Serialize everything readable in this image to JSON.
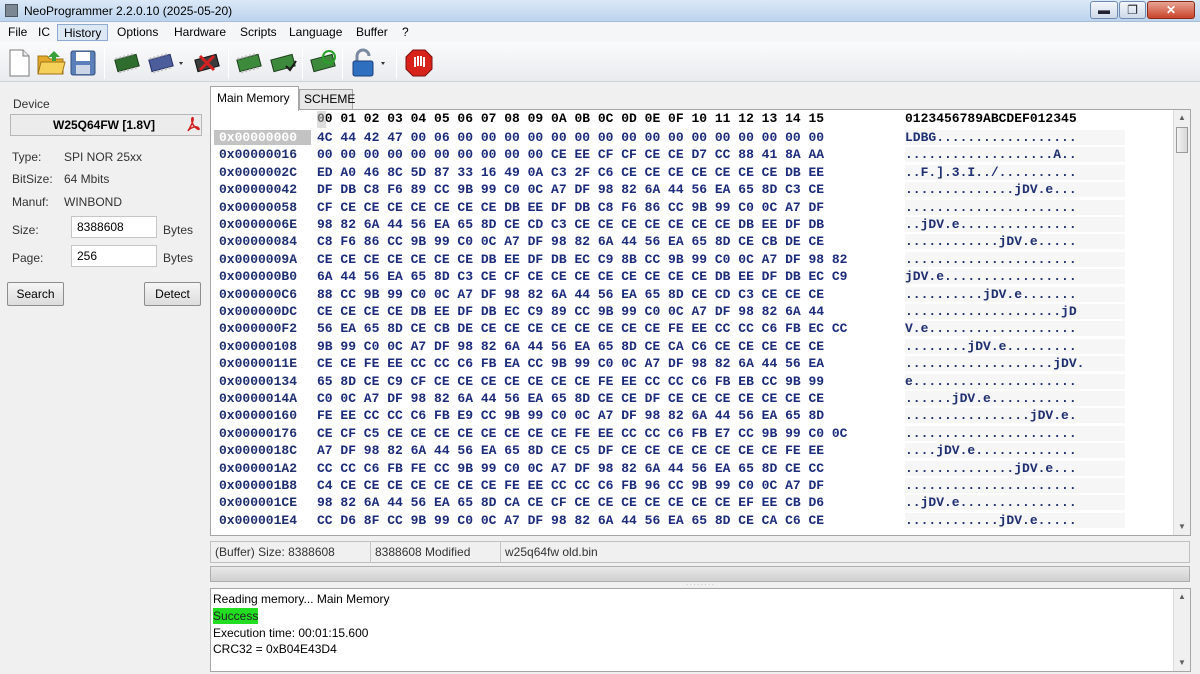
{
  "window": {
    "title": "NeoProgrammer 2.2.0.10 (2025-05-20)",
    "minimize": "▬",
    "maximize": "❐",
    "close": "✕"
  },
  "menu": [
    "File",
    "IC",
    "History",
    "Options",
    "Hardware",
    "Scripts",
    "Language",
    "Buffer",
    "?"
  ],
  "toolbar": {
    "icons": [
      "new-file-icon",
      "open-folder-icon",
      "save-icon",
      "chip-read-icon",
      "chip-id-dropdown-icon",
      "chip-erase-icon",
      "chip-write-icon",
      "chip-verify-icon",
      "chip-auto-icon",
      "lock-dropdown-icon",
      "stop-icon"
    ],
    "colors": {
      "chip": "#3a8a3a",
      "folder": "#f3c63a",
      "stop": "#d8231b",
      "lock": "#2f6fbf"
    }
  },
  "device": {
    "section_label": "Device",
    "name": "W25Q64FW [1.8V]",
    "type_label": "Type:",
    "type_value": "SPI NOR 25xx",
    "bitsize_label": "BitSize:",
    "bitsize_value": "64 Mbits",
    "manuf_label": "Manuf:",
    "manuf_value": "WINBOND",
    "size_label": "Size:",
    "size_value": "8388608",
    "size_unit": "Bytes",
    "page_label": "Page:",
    "page_value": "256",
    "page_unit": "Bytes",
    "search_button": "Search",
    "detect_button": "Detect"
  },
  "tabs": [
    "Main Memory",
    "SCHEME"
  ],
  "hex": {
    "header_cols": "00 01 02 03 04 05 06 07 08 09 0A 0B 0C 0D 0E 0F 10 11 12 13 14 15",
    "header_ascii": "0123456789ABCDEF012345",
    "rows": [
      {
        "addr": "0x00000000",
        "bytes": "4C 44 42 47 00 06 00 00 00 00 00 00 00 00 00 00 00 00 00 00 00 00",
        "ascii": "LDBG.................."
      },
      {
        "addr": "0x00000016",
        "bytes": "00 00 00 00 00 00 00 00 00 00 CE EE CF CF CE CE D7 CC 88 41 8A AA",
        "ascii": "...................A.."
      },
      {
        "addr": "0x0000002C",
        "bytes": "ED A0 46 8C 5D 87 33 16 49 0A C3 2F C6 CE CE CE CE CE CE CE DB EE",
        "ascii": "..F.].3.I../.........."
      },
      {
        "addr": "0x00000042",
        "bytes": "DF DB C8 F6 89 CC 9B 99 C0 0C A7 DF 98 82 6A 44 56 EA 65 8D C3 CE",
        "ascii": "..............jDV.e..."
      },
      {
        "addr": "0x00000058",
        "bytes": "CF CE CE CE CE CE CE CE DB EE DF DB C8 F6 86 CC 9B 99 C0 0C A7 DF",
        "ascii": "......................"
      },
      {
        "addr": "0x0000006E",
        "bytes": "98 82 6A 44 56 EA 65 8D CE CD C3 CE CE CE CE CE CE CE DB EE DF DB",
        "ascii": "..jDV.e..............."
      },
      {
        "addr": "0x00000084",
        "bytes": "C8 F6 86 CC 9B 99 C0 0C A7 DF 98 82 6A 44 56 EA 65 8D CE CB DE CE",
        "ascii": "............jDV.e....."
      },
      {
        "addr": "0x0000009A",
        "bytes": "CE CE CE CE CE CE CE DB EE DF DB EC C9 8B CC 9B 99 C0 0C A7 DF 98 82",
        "ascii": "......................"
      },
      {
        "addr": "0x000000B0",
        "bytes": "6A 44 56 EA 65 8D C3 CE CF CE CE CE CE CE CE CE CE DB EE DF DB EC C9",
        "ascii": "jDV.e................."
      },
      {
        "addr": "0x000000C6",
        "bytes": "88 CC 9B 99 C0 0C A7 DF 98 82 6A 44 56 EA 65 8D CE CD C3 CE CE CE",
        "ascii": "..........jDV.e......."
      },
      {
        "addr": "0x000000DC",
        "bytes": "CE CE CE CE DB EE DF DB EC C9 89 CC 9B 99 C0 0C A7 DF 98 82 6A 44",
        "ascii": "....................jD"
      },
      {
        "addr": "0x000000F2",
        "bytes": "56 EA 65 8D CE CB DE CE CE CE CE CE CE CE CE FE EE CC CC C6 FB EC CC",
        "ascii": "V.e..................."
      },
      {
        "addr": "0x00000108",
        "bytes": "9B 99 C0 0C A7 DF 98 82 6A 44 56 EA 65 8D CE CA C6 CE CE CE CE CE",
        "ascii": "........jDV.e........."
      },
      {
        "addr": "0x0000011E",
        "bytes": "CE CE FE EE CC CC C6 FB EA CC 9B 99 C0 0C A7 DF 98 82 6A 44 56 EA",
        "ascii": "...................jDV."
      },
      {
        "addr": "0x00000134",
        "bytes": "65 8D CE C9 CF CE CE CE CE CE CE CE FE EE CC CC C6 FB EB CC 9B 99",
        "ascii": "e....................."
      },
      {
        "addr": "0x0000014A",
        "bytes": "C0 0C A7 DF 98 82 6A 44 56 EA 65 8D CE CE DF CE CE CE CE CE CE CE",
        "ascii": "......jDV.e..........."
      },
      {
        "addr": "0x00000160",
        "bytes": "FE EE CC CC C6 FB E9 CC 9B 99 C0 0C A7 DF 98 82 6A 44 56 EA 65 8D",
        "ascii": "................jDV.e."
      },
      {
        "addr": "0x00000176",
        "bytes": "CE CF C5 CE CE CE CE CE CE CE CE FE EE CC CC C6 FB E7 CC 9B 99 C0 0C",
        "ascii": "......................"
      },
      {
        "addr": "0x0000018C",
        "bytes": "A7 DF 98 82 6A 44 56 EA 65 8D CE C5 DF CE CE CE CE CE CE CE FE EE",
        "ascii": "....jDV.e............."
      },
      {
        "addr": "0x000001A2",
        "bytes": "CC CC C6 FB FE CC 9B 99 C0 0C A7 DF 98 82 6A 44 56 EA 65 8D CE CC",
        "ascii": "..............jDV.e..."
      },
      {
        "addr": "0x000001B8",
        "bytes": "C4 CE CE CE CE CE CE CE FE EE CC CC C6 FB 96 CC 9B 99 C0 0C A7 DF",
        "ascii": "......................"
      },
      {
        "addr": "0x000001CE",
        "bytes": "98 82 6A 44 56 EA 65 8D CA CE CF CE CE CE CE CE CE CE EF EE CB D6",
        "ascii": "..jDV.e..............."
      },
      {
        "addr": "0x000001E4",
        "bytes": "CC D6 8F CC 9B 99 C0 0C A7 DF 98 82 6A 44 56 EA 65 8D CE CA C6 CE",
        "ascii": "............jDV.e....."
      }
    ]
  },
  "status": {
    "buffer_size": "(Buffer) Size: 8388608",
    "modified": "8388608 Modified",
    "filename": "w25q64fw old.bin"
  },
  "log": {
    "lines": [
      "Reading memory... Main Memory",
      "Success",
      "Execution time: 00:01:15.600",
      "CRC32 = 0xB04E43D4"
    ]
  }
}
